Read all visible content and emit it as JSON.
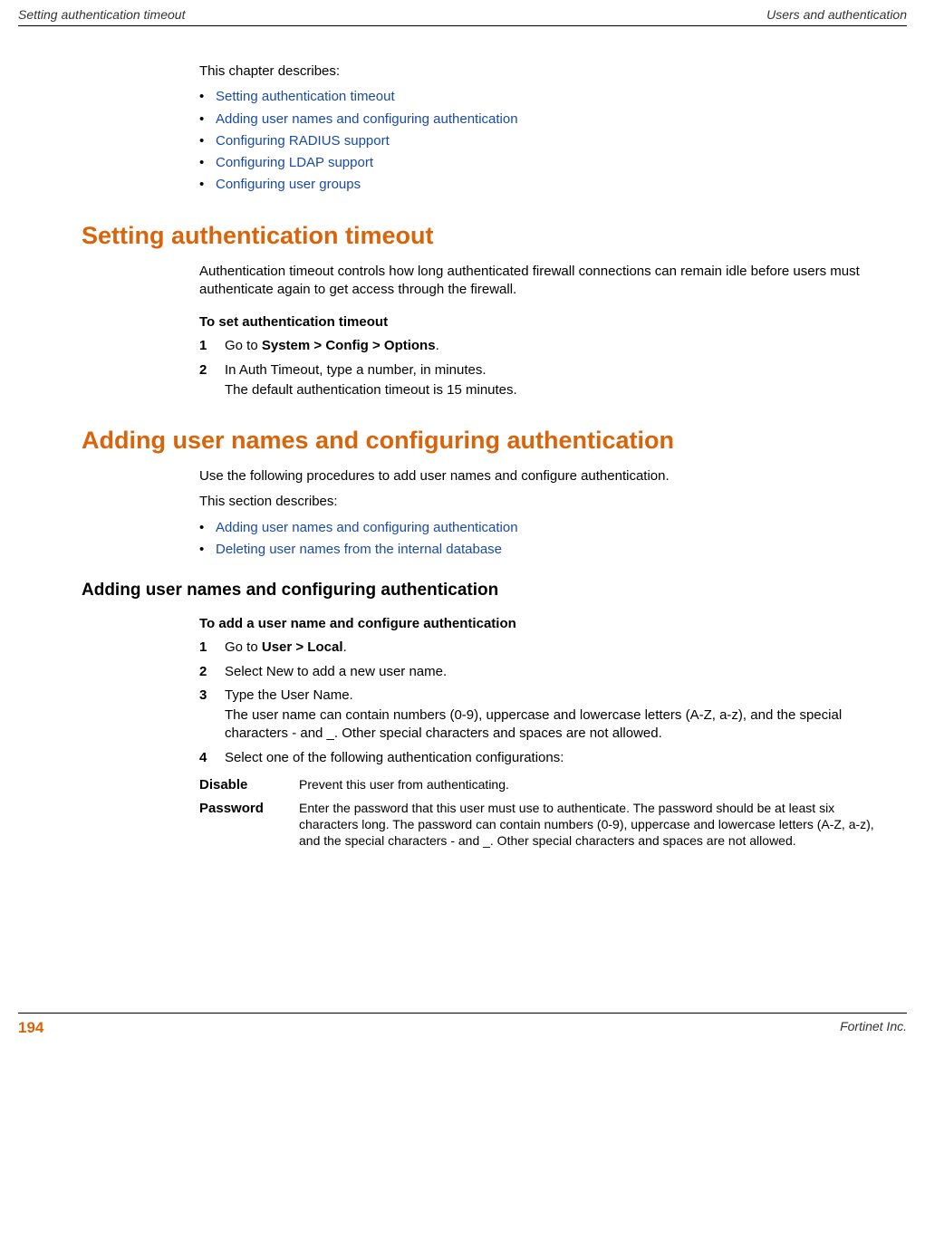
{
  "header": {
    "left": "Setting authentication timeout",
    "right": "Users and authentication"
  },
  "intro": {
    "text": "This chapter describes:",
    "links": [
      "Setting authentication timeout",
      "Adding user names and configuring authentication",
      "Configuring RADIUS support",
      "Configuring LDAP support",
      "Configuring user groups"
    ]
  },
  "section1": {
    "title": "Setting authentication timeout",
    "para": "Authentication timeout controls how long authenticated firewall connections can remain idle before users must authenticate again to get access through the firewall.",
    "proc_title": "To set authentication timeout",
    "steps": {
      "s1_num": "1",
      "s1_pre": "Go to ",
      "s1_bold": "System > Config > Options",
      "s1_post": ".",
      "s2_num": "2",
      "s2_line1": "In Auth Timeout, type a number, in minutes.",
      "s2_line2": "The default authentication timeout is 15 minutes."
    }
  },
  "section2": {
    "title": "Adding user names and configuring authentication",
    "para1": "Use the following procedures to add user names and configure authentication.",
    "para2": "This section describes:",
    "links": [
      "Adding user names and configuring authentication",
      "Deleting user names from the internal database"
    ],
    "subsection_title": "Adding user names and configuring authentication",
    "proc_title": "To add a user name and configure authentication",
    "steps": {
      "s1_num": "1",
      "s1_pre": "Go to ",
      "s1_bold": "User > Local",
      "s1_post": ".",
      "s2_num": "2",
      "s2_text": "Select New to add a new user name.",
      "s3_num": "3",
      "s3_line1": "Type the User Name.",
      "s3_line2": "The user name can contain numbers (0-9), uppercase and lowercase letters (A-Z, a-z), and the special characters - and _. Other special characters and spaces are not allowed.",
      "s4_num": "4",
      "s4_text": "Select one of the following authentication configurations:"
    },
    "defs": {
      "d1_term": "Disable",
      "d1_desc": "Prevent this user from authenticating.",
      "d2_term": "Password",
      "d2_desc": "Enter the password that this user must use to authenticate. The password should be at least six characters long. The password can contain numbers (0-9), uppercase and lowercase letters (A-Z, a-z), and the special characters - and _. Other special characters and spaces are not allowed."
    }
  },
  "footer": {
    "page": "194",
    "right": "Fortinet Inc."
  }
}
